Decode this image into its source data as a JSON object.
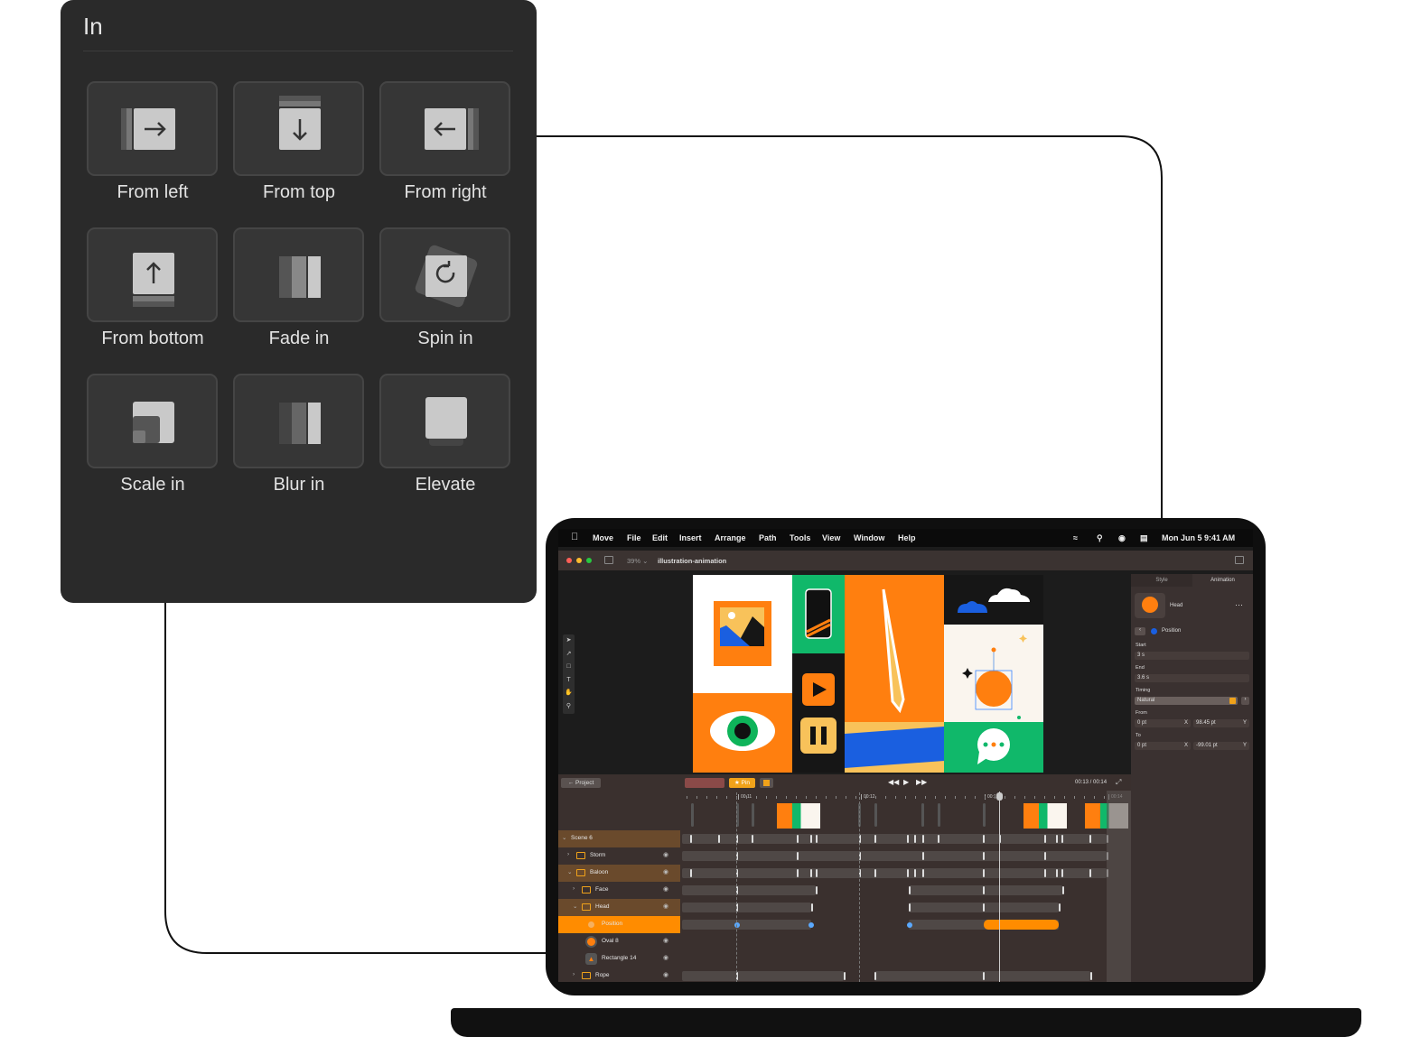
{
  "panel": {
    "title": "In",
    "presets": [
      {
        "label": "From left",
        "icon": "slide-from-left-icon"
      },
      {
        "label": "From top",
        "icon": "slide-from-top-icon"
      },
      {
        "label": "From right",
        "icon": "slide-from-right-icon"
      },
      {
        "label": "From bottom",
        "icon": "slide-from-bottom-icon"
      },
      {
        "label": "Fade in",
        "icon": "fade-in-icon"
      },
      {
        "label": "Spin in",
        "icon": "spin-in-icon"
      },
      {
        "label": "Scale in",
        "icon": "scale-in-icon"
      },
      {
        "label": "Blur in",
        "icon": "blur-in-icon"
      },
      {
        "label": "Elevate",
        "icon": "elevate-icon"
      }
    ]
  },
  "menubar": {
    "items": [
      "Move",
      "File",
      "Edit",
      "Insert",
      "Arrange",
      "Path",
      "Tools",
      "View",
      "Window",
      "Help"
    ],
    "clock": "Mon Jun 5  9:41 AM"
  },
  "window": {
    "zoom": "39%",
    "title": "illustration-animation"
  },
  "inspector": {
    "tabs": [
      "Style",
      "Animation"
    ],
    "active_tab": "Animation",
    "layer_name": "Head",
    "animation": "Position",
    "start_label": "Start",
    "start": "3 s",
    "end_label": "End",
    "end": "3.6 s",
    "timing_label": "Timing",
    "timing": "Natural",
    "from_label": "From",
    "from_x": "0 pt",
    "from_y": "98.45 pt",
    "to_label": "To",
    "to_x": "0 pt",
    "to_y": "-99.01 pt",
    "x_axis": "X",
    "y_axis": "Y"
  },
  "timeline": {
    "back_label": "Project",
    "pin_label": "Pin",
    "time": "00:13 / 00:14",
    "ruler": [
      "00:11",
      "00:12",
      "00:13",
      "00:14"
    ],
    "layers": [
      {
        "name": "Scene 6"
      },
      {
        "name": "Storm"
      },
      {
        "name": "Baloon"
      },
      {
        "name": "Face"
      },
      {
        "name": "Head"
      },
      {
        "name": "Position"
      },
      {
        "name": "Oval 8"
      },
      {
        "name": "Rectangle 14"
      },
      {
        "name": "Rope"
      }
    ]
  },
  "colors": {
    "accent": "#ff8c00",
    "panel_bg": "#2a2a2a",
    "keyframe": "#5aa9ff"
  }
}
